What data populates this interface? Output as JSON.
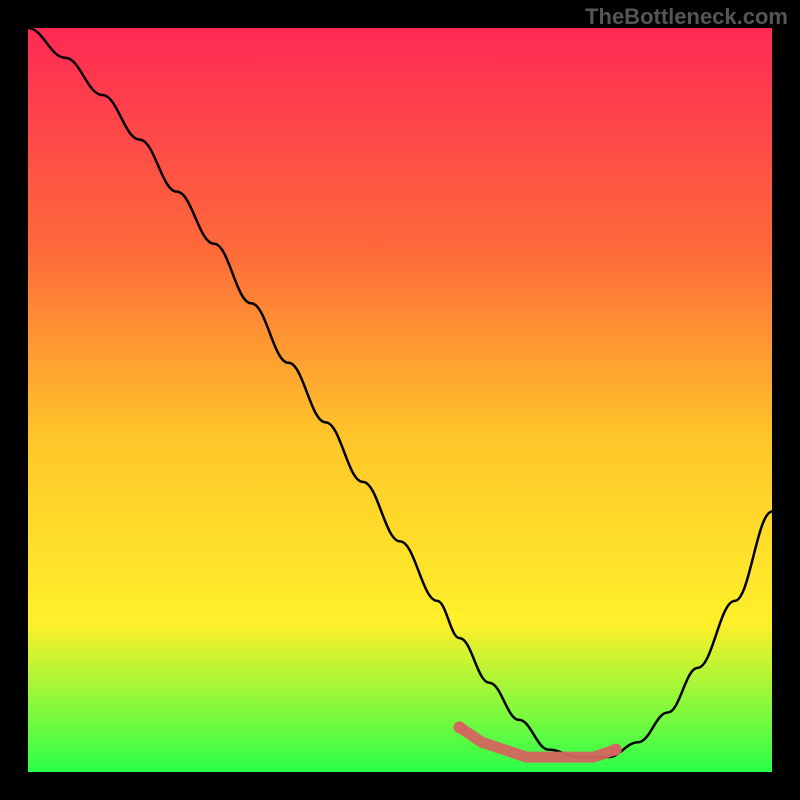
{
  "watermark": "TheBottleneck.com",
  "colors": {
    "gradient_top": "#ff2a55",
    "gradient_mid_upper": "#ff6a3a",
    "gradient_mid": "#ffc629",
    "gradient_mid_lower": "#fff02a",
    "gradient_bottom": "#2aff4a",
    "curve": "#000000",
    "marker": "#d4655f",
    "background": "#000000"
  },
  "chart_data": {
    "type": "line",
    "title": "",
    "xlabel": "",
    "ylabel": "",
    "xlim": [
      0,
      100
    ],
    "ylim": [
      0,
      100
    ],
    "grid": false,
    "legend": false,
    "series": [
      {
        "name": "curve",
        "x": [
          0,
          5,
          10,
          15,
          20,
          25,
          30,
          35,
          40,
          45,
          50,
          55,
          58,
          62,
          66,
          70,
          74,
          78,
          82,
          86,
          90,
          95,
          100
        ],
        "values": [
          100,
          96,
          91,
          85,
          78,
          71,
          63,
          55,
          47,
          39,
          31,
          23,
          18,
          12,
          7,
          3,
          2,
          2,
          4,
          8,
          14,
          23,
          35
        ]
      }
    ],
    "markers": {
      "name": "bottleneck-region",
      "x": [
        58,
        61,
        64,
        67,
        70,
        73,
        76,
        79
      ],
      "values": [
        6,
        4,
        3,
        2,
        2,
        2,
        2,
        3
      ]
    }
  }
}
